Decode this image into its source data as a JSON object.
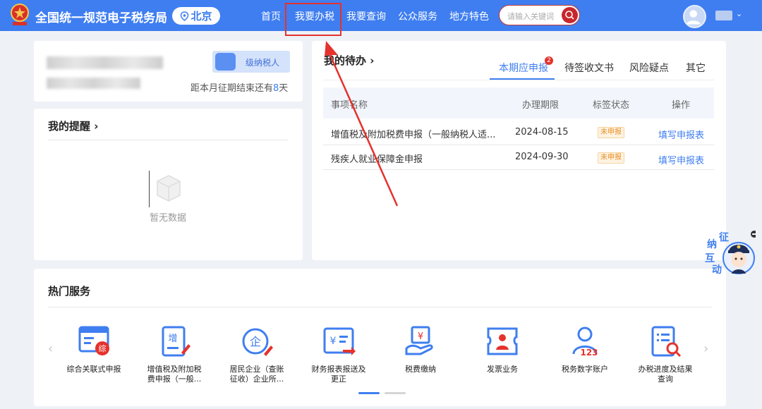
{
  "header": {
    "site_title": "全国统一规范电子税务局",
    "city": "北京",
    "nav": [
      "首页",
      "我要办税",
      "我要查询",
      "公众服务",
      "地方特色"
    ],
    "search_placeholder": "请输入关键词"
  },
  "account": {
    "taxpayer_type": "级纳税人",
    "countdown_prefix": "距本月征期结束还有",
    "countdown_days": "8",
    "countdown_suffix": "天"
  },
  "reminders": {
    "title": "我的提醒 ›",
    "empty_text": "暂无数据"
  },
  "todo": {
    "title": "我的待办 ›",
    "tabs": [
      "本期应申报",
      "待签收文书",
      "风险疑点",
      "其它"
    ],
    "badge_count": "2",
    "columns": [
      "事项名称",
      "办理期限",
      "标签状态",
      "操作"
    ],
    "rows": [
      {
        "name": "增值税及附加税费申报（一般纳税人适...",
        "deadline": "2024-08-15",
        "status": "未申报",
        "action": "填写申报表"
      },
      {
        "name": "残疾人就业保障金申报",
        "deadline": "2024-09-30",
        "status": "未申报",
        "action": "填写申报表"
      }
    ]
  },
  "hot_services": {
    "title": "热门服务",
    "items": [
      {
        "line1": "综合关联式申报",
        "line2": "",
        "icon": "comprehensive-report-icon"
      },
      {
        "line1": "增值税及附加税",
        "line2": "费申报（一般...",
        "icon": "vat-report-icon"
      },
      {
        "line1": "居民企业（查账",
        "line2": "征收）企业所...",
        "icon": "enterprise-tax-icon"
      },
      {
        "line1": "财务报表报送及",
        "line2": "更正",
        "icon": "financial-statement-icon"
      },
      {
        "line1": "税费缴纳",
        "line2": "",
        "icon": "tax-payment-icon"
      },
      {
        "line1": "发票业务",
        "line2": "",
        "icon": "invoice-icon"
      },
      {
        "line1": "税务数字账户",
        "line2": "",
        "icon": "digital-account-icon"
      },
      {
        "line1": "办税进度及结果",
        "line2": "查询",
        "icon": "progress-query-icon"
      }
    ]
  },
  "widget": {
    "chars": [
      "征",
      "纳",
      "互",
      "动"
    ]
  },
  "colors": {
    "primary": "#3f7ef0",
    "highlight": "#e5322d",
    "status_orange": "#e8912c"
  }
}
